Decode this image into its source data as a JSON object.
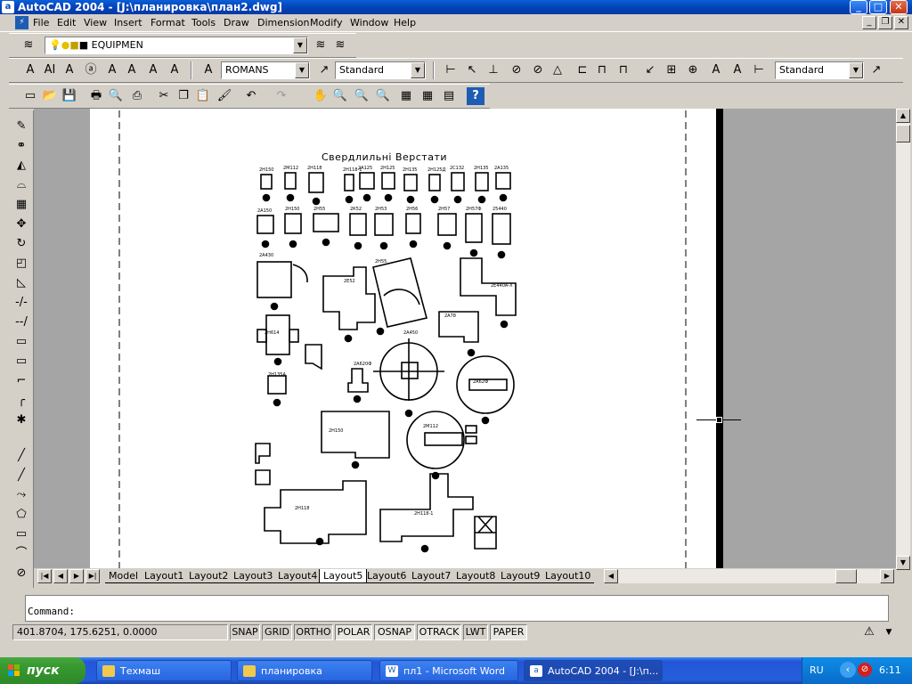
{
  "window": {
    "title": "AutoCAD 2004 - [J:\\планировка\\план2.dwg]",
    "min_label": "_",
    "max_label": "□",
    "close_label": "✕"
  },
  "menu": [
    "File",
    "Edit",
    "View",
    "Insert",
    "Format",
    "Tools",
    "Draw",
    "Dimension",
    "Modify",
    "Window",
    "Help"
  ],
  "mdi": {
    "min": "_",
    "restore": "❐",
    "close": "✕"
  },
  "layer": {
    "name": "EQUIPMEN"
  },
  "text_style": {
    "font": "ROMANS",
    "style": "Standard"
  },
  "dim_style": {
    "style": "Standard"
  },
  "drawing": {
    "title": "Свердлильні Верстати",
    "labels": [
      "2Н150",
      "2М112",
      "2Н118",
      "2Н118-1",
      "2А125",
      "2Н125",
      "2Н135",
      "2Н125Д",
      "2С132",
      "2Н135",
      "2А135",
      "2А150",
      "2Н150",
      "2Н55",
      "2К52",
      "2Н53",
      "2Н56",
      "2Н57",
      "2Н57Ф",
      "25440",
      "2А430",
      "2Е52",
      "2Н55",
      "2Е440А-Х",
      "2А78",
      "2Н614",
      "2А450",
      "2А620Ф",
      "2А62Ф",
      "2Н135А"
    ]
  },
  "tabs": [
    "Model",
    "Layout1",
    "Layout2",
    "Layout3",
    "Layout4",
    "Layout5",
    "Layout6",
    "Layout7",
    "Layout8",
    "Layout9",
    "Layout10"
  ],
  "active_tab": "Layout5",
  "command": {
    "prompt": "Command:"
  },
  "status": {
    "coords": "401.8704, 175.6251, 0.0000",
    "buttons": [
      "SNAP",
      "GRID",
      "ORTHO",
      "POLAR",
      "OSNAP",
      "OTRACK",
      "LWT",
      "PAPER"
    ],
    "pressed": [
      "POLAR",
      "OSNAP",
      "OTRACK",
      "PAPER"
    ]
  },
  "taskbar": {
    "start": "пуск",
    "tasks": [
      "Техмаш",
      "планировка",
      "пл1 - Microsoft Word",
      "AutoCAD 2004 - [J:\\п..."
    ],
    "lang": "RU",
    "time": "6:11"
  }
}
